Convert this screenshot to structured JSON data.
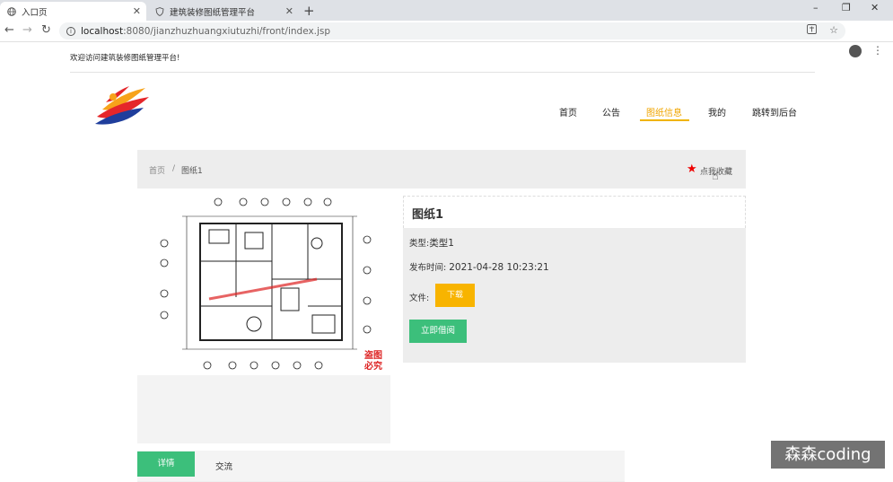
{
  "browser": {
    "tabs": [
      {
        "label": "入口页"
      },
      {
        "label": "建筑装修图纸管理平台"
      }
    ],
    "new_tab": "+",
    "window_controls": [
      "–",
      "❐",
      "✕"
    ],
    "url_host": "localhost",
    "url_path": ":8080/jianzhuzhuangxiutuzhi/front/index.jsp"
  },
  "header": {
    "welcome": "欢迎访问建筑装修图纸管理平台!",
    "nav": [
      {
        "label": "首页"
      },
      {
        "label": "公告"
      },
      {
        "label": "图纸信息"
      },
      {
        "label": "我的"
      },
      {
        "label": "跳转到后台"
      }
    ]
  },
  "breadcrumb": {
    "home": "首页",
    "sep": "/",
    "current": "图纸1"
  },
  "favorite": {
    "label": "点我收藏"
  },
  "detail": {
    "title": "图纸1",
    "type_label": "类型:",
    "type_value": "类型1",
    "time_label": "发布时间:",
    "time_value": "2021-04-28 10:23:21",
    "file_label": "文件:",
    "download_label": "下载",
    "borrow_label": "立即借阅",
    "stamp_text": "盗图必究"
  },
  "tabs": [
    {
      "label": "详情"
    },
    {
      "label": "交流"
    }
  ],
  "watermark": "森森coding",
  "colors": {
    "accent_yellow": "#f0b400",
    "accent_green": "#3cbf7b",
    "favorite_red": "#ee0000"
  }
}
